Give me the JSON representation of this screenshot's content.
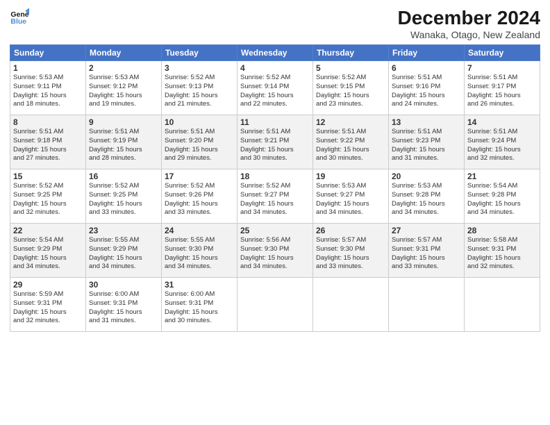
{
  "header": {
    "logo_line1": "General",
    "logo_line2": "Blue",
    "title": "December 2024",
    "subtitle": "Wanaka, Otago, New Zealand"
  },
  "columns": [
    "Sunday",
    "Monday",
    "Tuesday",
    "Wednesday",
    "Thursday",
    "Friday",
    "Saturday"
  ],
  "weeks": [
    [
      {
        "day": "1",
        "info": "Sunrise: 5:53 AM\nSunset: 9:11 PM\nDaylight: 15 hours\nand 18 minutes."
      },
      {
        "day": "2",
        "info": "Sunrise: 5:53 AM\nSunset: 9:12 PM\nDaylight: 15 hours\nand 19 minutes."
      },
      {
        "day": "3",
        "info": "Sunrise: 5:52 AM\nSunset: 9:13 PM\nDaylight: 15 hours\nand 21 minutes."
      },
      {
        "day": "4",
        "info": "Sunrise: 5:52 AM\nSunset: 9:14 PM\nDaylight: 15 hours\nand 22 minutes."
      },
      {
        "day": "5",
        "info": "Sunrise: 5:52 AM\nSunset: 9:15 PM\nDaylight: 15 hours\nand 23 minutes."
      },
      {
        "day": "6",
        "info": "Sunrise: 5:51 AM\nSunset: 9:16 PM\nDaylight: 15 hours\nand 24 minutes."
      },
      {
        "day": "7",
        "info": "Sunrise: 5:51 AM\nSunset: 9:17 PM\nDaylight: 15 hours\nand 26 minutes."
      }
    ],
    [
      {
        "day": "8",
        "info": "Sunrise: 5:51 AM\nSunset: 9:18 PM\nDaylight: 15 hours\nand 27 minutes."
      },
      {
        "day": "9",
        "info": "Sunrise: 5:51 AM\nSunset: 9:19 PM\nDaylight: 15 hours\nand 28 minutes."
      },
      {
        "day": "10",
        "info": "Sunrise: 5:51 AM\nSunset: 9:20 PM\nDaylight: 15 hours\nand 29 minutes."
      },
      {
        "day": "11",
        "info": "Sunrise: 5:51 AM\nSunset: 9:21 PM\nDaylight: 15 hours\nand 30 minutes."
      },
      {
        "day": "12",
        "info": "Sunrise: 5:51 AM\nSunset: 9:22 PM\nDaylight: 15 hours\nand 30 minutes."
      },
      {
        "day": "13",
        "info": "Sunrise: 5:51 AM\nSunset: 9:23 PM\nDaylight: 15 hours\nand 31 minutes."
      },
      {
        "day": "14",
        "info": "Sunrise: 5:51 AM\nSunset: 9:24 PM\nDaylight: 15 hours\nand 32 minutes."
      }
    ],
    [
      {
        "day": "15",
        "info": "Sunrise: 5:52 AM\nSunset: 9:25 PM\nDaylight: 15 hours\nand 32 minutes."
      },
      {
        "day": "16",
        "info": "Sunrise: 5:52 AM\nSunset: 9:25 PM\nDaylight: 15 hours\nand 33 minutes."
      },
      {
        "day": "17",
        "info": "Sunrise: 5:52 AM\nSunset: 9:26 PM\nDaylight: 15 hours\nand 33 minutes."
      },
      {
        "day": "18",
        "info": "Sunrise: 5:52 AM\nSunset: 9:27 PM\nDaylight: 15 hours\nand 34 minutes."
      },
      {
        "day": "19",
        "info": "Sunrise: 5:53 AM\nSunset: 9:27 PM\nDaylight: 15 hours\nand 34 minutes."
      },
      {
        "day": "20",
        "info": "Sunrise: 5:53 AM\nSunset: 9:28 PM\nDaylight: 15 hours\nand 34 minutes."
      },
      {
        "day": "21",
        "info": "Sunrise: 5:54 AM\nSunset: 9:28 PM\nDaylight: 15 hours\nand 34 minutes."
      }
    ],
    [
      {
        "day": "22",
        "info": "Sunrise: 5:54 AM\nSunset: 9:29 PM\nDaylight: 15 hours\nand 34 minutes."
      },
      {
        "day": "23",
        "info": "Sunrise: 5:55 AM\nSunset: 9:29 PM\nDaylight: 15 hours\nand 34 minutes."
      },
      {
        "day": "24",
        "info": "Sunrise: 5:55 AM\nSunset: 9:30 PM\nDaylight: 15 hours\nand 34 minutes."
      },
      {
        "day": "25",
        "info": "Sunrise: 5:56 AM\nSunset: 9:30 PM\nDaylight: 15 hours\nand 34 minutes."
      },
      {
        "day": "26",
        "info": "Sunrise: 5:57 AM\nSunset: 9:30 PM\nDaylight: 15 hours\nand 33 minutes."
      },
      {
        "day": "27",
        "info": "Sunrise: 5:57 AM\nSunset: 9:31 PM\nDaylight: 15 hours\nand 33 minutes."
      },
      {
        "day": "28",
        "info": "Sunrise: 5:58 AM\nSunset: 9:31 PM\nDaylight: 15 hours\nand 32 minutes."
      }
    ],
    [
      {
        "day": "29",
        "info": "Sunrise: 5:59 AM\nSunset: 9:31 PM\nDaylight: 15 hours\nand 32 minutes."
      },
      {
        "day": "30",
        "info": "Sunrise: 6:00 AM\nSunset: 9:31 PM\nDaylight: 15 hours\nand 31 minutes."
      },
      {
        "day": "31",
        "info": "Sunrise: 6:00 AM\nSunset: 9:31 PM\nDaylight: 15 hours\nand 30 minutes."
      },
      null,
      null,
      null,
      null
    ]
  ]
}
